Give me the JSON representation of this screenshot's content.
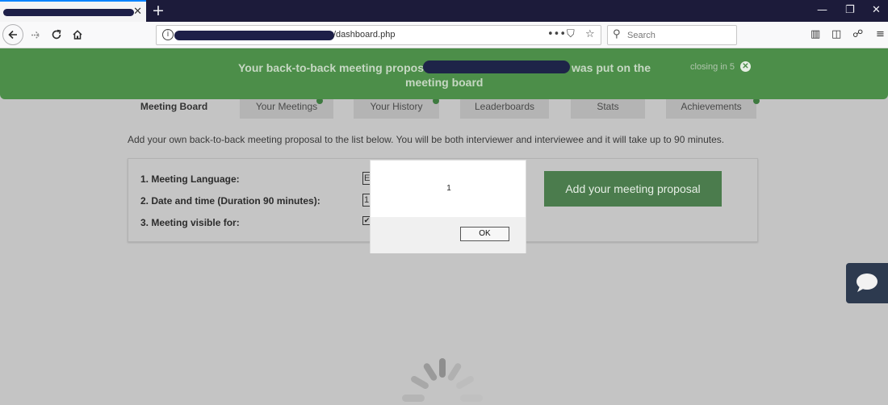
{
  "browser": {
    "new_tab_label": "+",
    "tab_close": "✕",
    "address_suffix": "/dashboard.php",
    "search_placeholder": "Search",
    "window_buttons": {
      "minimize": "—",
      "restore": "❐",
      "close": "✕"
    }
  },
  "banner": {
    "message_start": "Your back-to-back meeting proposal",
    "message_end": "was put on the",
    "message_line2": "meeting board",
    "closing_text": "closing in 5",
    "close_symbol": "✕",
    "color": "#4c8e49"
  },
  "dashboard": {
    "tabs": [
      {
        "label": "Meeting Board"
      },
      {
        "label": "Your Meetings"
      },
      {
        "label": "Your History"
      },
      {
        "label": "Leaderboards"
      },
      {
        "label": "Stats"
      },
      {
        "label": "Achievements"
      }
    ],
    "intro": "Add your own back-to-back meeting proposal to the list below. You will be both interviewer and interviewee and it will take up to 90 minutes.",
    "form": {
      "language_label": "1. Meeting Language:",
      "language_value": "E",
      "datetime_label": "2. Date and time (Duration 90 minutes):",
      "datetime_value": "1",
      "visible_label": "3. Meeting visible for:",
      "visible_checked": "✔"
    },
    "add_button": "Add your meeting proposal",
    "accent_color": "#4b7c4d"
  },
  "alert": {
    "message": "1",
    "ok_label": "OK"
  },
  "icons": {
    "back": "back-icon",
    "forward": "forward-icon",
    "reload": "reload-icon",
    "home": "home-icon",
    "chat": "chat-icon"
  }
}
